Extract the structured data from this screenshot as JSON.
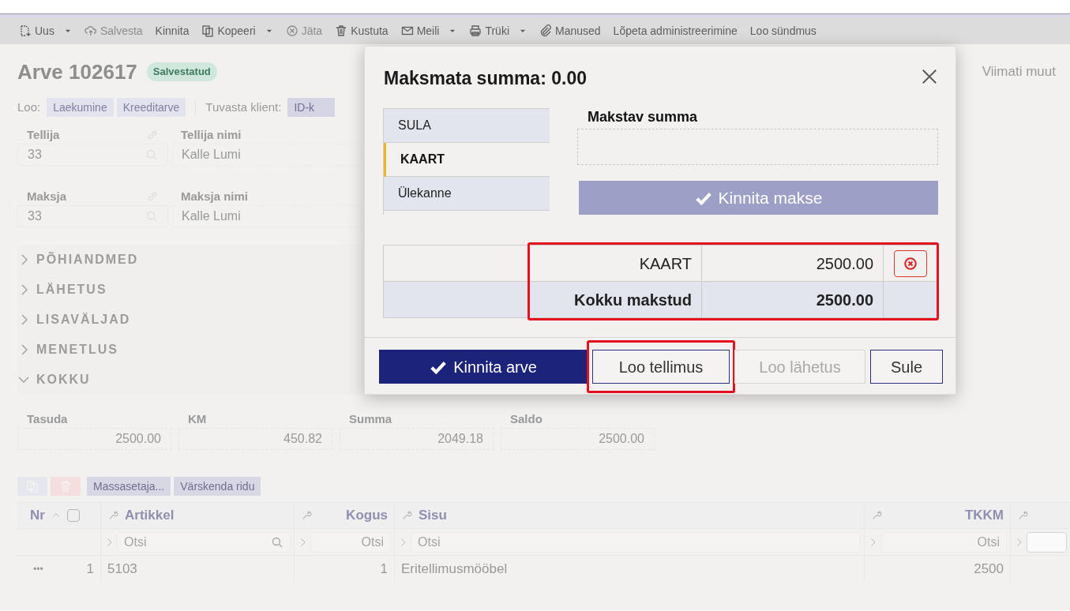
{
  "toolbar": [
    {
      "label": "Uus",
      "kind": "new",
      "dropdown": true,
      "disabled": false
    },
    {
      "label": "Salvesta",
      "kind": "upload",
      "dropdown": false,
      "disabled": true
    },
    {
      "label": "Kinnita",
      "kind": "text",
      "dropdown": false,
      "disabled": false
    },
    {
      "label": "Kopeeri",
      "kind": "copy",
      "dropdown": true,
      "disabled": false
    },
    {
      "label": "Jäta",
      "kind": "cancel",
      "dropdown": false,
      "disabled": true
    },
    {
      "label": "Kustuta",
      "kind": "trash",
      "dropdown": false,
      "disabled": false
    },
    {
      "label": "Meili",
      "kind": "mail",
      "dropdown": true,
      "disabled": false
    },
    {
      "label": "Trüki",
      "kind": "print",
      "dropdown": true,
      "disabled": false
    },
    {
      "label": "Manused",
      "kind": "clip",
      "dropdown": false,
      "disabled": false
    },
    {
      "label": "Lõpeta administreerimine",
      "kind": "text",
      "dropdown": false,
      "disabled": false
    },
    {
      "label": "Loo sündmus",
      "kind": "text",
      "dropdown": false,
      "disabled": false
    }
  ],
  "header": {
    "title": "Arve 102617",
    "badge": "Salvestatud",
    "last_modified": "Viimati muut"
  },
  "create_row": {
    "label": "Loo:",
    "buttons": [
      "Laekumine",
      "Kreeditarve"
    ],
    "identify_label": "Tuvasta klient:",
    "identify_button": "ID-k"
  },
  "fields": [
    {
      "label": "Tellija",
      "value": "33",
      "name_label": "Tellija nimi",
      "name_value": "Kalle Lumi"
    },
    {
      "label": "Maksja",
      "value": "33",
      "name_label": "Maksja nimi",
      "name_value": "Kalle Lumi"
    }
  ],
  "sections": [
    {
      "label": "PÕHIANDMED",
      "expanded": false
    },
    {
      "label": "LÄHETUS",
      "expanded": false
    },
    {
      "label": "LISAVÄLJAD",
      "expanded": false
    },
    {
      "label": "MENETLUS",
      "expanded": false
    },
    {
      "label": "KOKKU",
      "expanded": true
    }
  ],
  "totals": [
    {
      "label": "Tasuda",
      "value": "2500.00"
    },
    {
      "label": "KM",
      "value": "450.82"
    },
    {
      "label": "Summa",
      "value": "2049.18"
    },
    {
      "label": "Saldo",
      "value": "2500.00"
    }
  ],
  "grid_buttons": [
    "Massasetaja...",
    "Värskenda ridu"
  ],
  "table": {
    "select_all_checked": false,
    "columns": [
      "Nr",
      "Artikkel",
      "Kogus",
      "Sisu",
      "TKKM"
    ],
    "filters": [
      "Otsi",
      "Otsi",
      "Otsi",
      "Otsi"
    ],
    "rows": [
      {
        "menu": "•••",
        "cells": [
          "1",
          "5103",
          "1",
          "Eritellimusmööbel",
          "2500"
        ]
      }
    ]
  },
  "dialog": {
    "title": "Maksmata summa: 0.00",
    "methods": [
      {
        "label": "SULA",
        "selected": false
      },
      {
        "label": "KAART",
        "selected": true
      },
      {
        "label": "Ülekanne",
        "selected": false
      }
    ],
    "amount_label": "Makstav summa",
    "confirm_button": "Kinnita makse",
    "payments": [
      {
        "method": "KAART",
        "amount": "2500.00"
      }
    ],
    "total": {
      "label": "Kokku makstud",
      "amount": "2500.00"
    },
    "payments_highlighted": true,
    "buttons": [
      {
        "label": "Kinnita arve",
        "kind": "primary",
        "disabled": false,
        "highlighted": false
      },
      {
        "label": "Loo tellimus",
        "kind": "outline",
        "disabled": false,
        "highlighted": true
      },
      {
        "label": "Loo lähetus",
        "kind": "outline",
        "disabled": true,
        "highlighted": false
      },
      {
        "label": "Sule",
        "kind": "outline",
        "disabled": false,
        "highlighted": false
      }
    ]
  }
}
